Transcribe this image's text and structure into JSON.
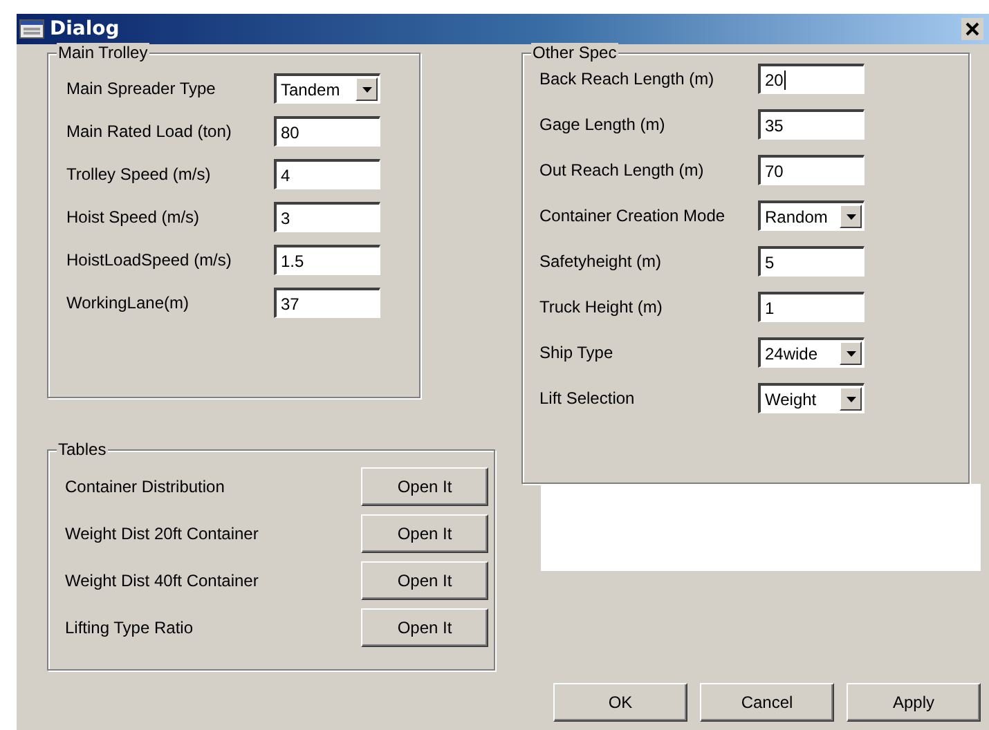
{
  "window": {
    "title": "Dialog"
  },
  "main_trolley": {
    "title": "Main Trolley",
    "fields": [
      {
        "kind": "select",
        "label": "Main Spreader Type",
        "value": "Tandem"
      },
      {
        "kind": "text",
        "label": "Main Rated Load (ton)",
        "value": "80",
        "focused": false
      },
      {
        "kind": "text",
        "label": "Trolley Speed (m/s)",
        "value": "4",
        "focused": false
      },
      {
        "kind": "text",
        "label": "Hoist Speed (m/s)",
        "value": "3",
        "focused": false
      },
      {
        "kind": "text",
        "label": "HoistLoadSpeed (m/s)",
        "value": "1.5",
        "focused": false
      },
      {
        "kind": "text",
        "label": "WorkingLane(m)",
        "value": "37",
        "focused": false
      }
    ]
  },
  "tables": {
    "title": "Tables",
    "rows": [
      {
        "label": "Container Distribution",
        "button": "Open It"
      },
      {
        "label": "Weight Dist 20ft Container",
        "button": "Open It"
      },
      {
        "label": "Weight Dist 40ft Container",
        "button": "Open It"
      },
      {
        "label": "Lifting Type Ratio",
        "button": "Open It"
      }
    ]
  },
  "other_spec": {
    "title": "Other Spec",
    "fields": [
      {
        "kind": "text",
        "label": "Back Reach Length (m)",
        "value": "20",
        "focused": true
      },
      {
        "kind": "text",
        "label": "Gage Length (m)",
        "value": "35",
        "focused": false
      },
      {
        "kind": "text",
        "label": "Out Reach Length (m)",
        "value": "70",
        "focused": false
      },
      {
        "kind": "select",
        "label": "Container Creation Mode",
        "value": "Random"
      },
      {
        "kind": "text",
        "label": "Safetyheight (m)",
        "value": "5",
        "focused": false
      },
      {
        "kind": "text",
        "label": "Truck Height (m)",
        "value": "1",
        "focused": false
      },
      {
        "kind": "select",
        "label": "Ship Type",
        "value": "24wide"
      },
      {
        "kind": "select",
        "label": "Lift Selection",
        "value": "Weight"
      }
    ]
  },
  "buttons": [
    "OK",
    "Cancel",
    "Apply"
  ]
}
